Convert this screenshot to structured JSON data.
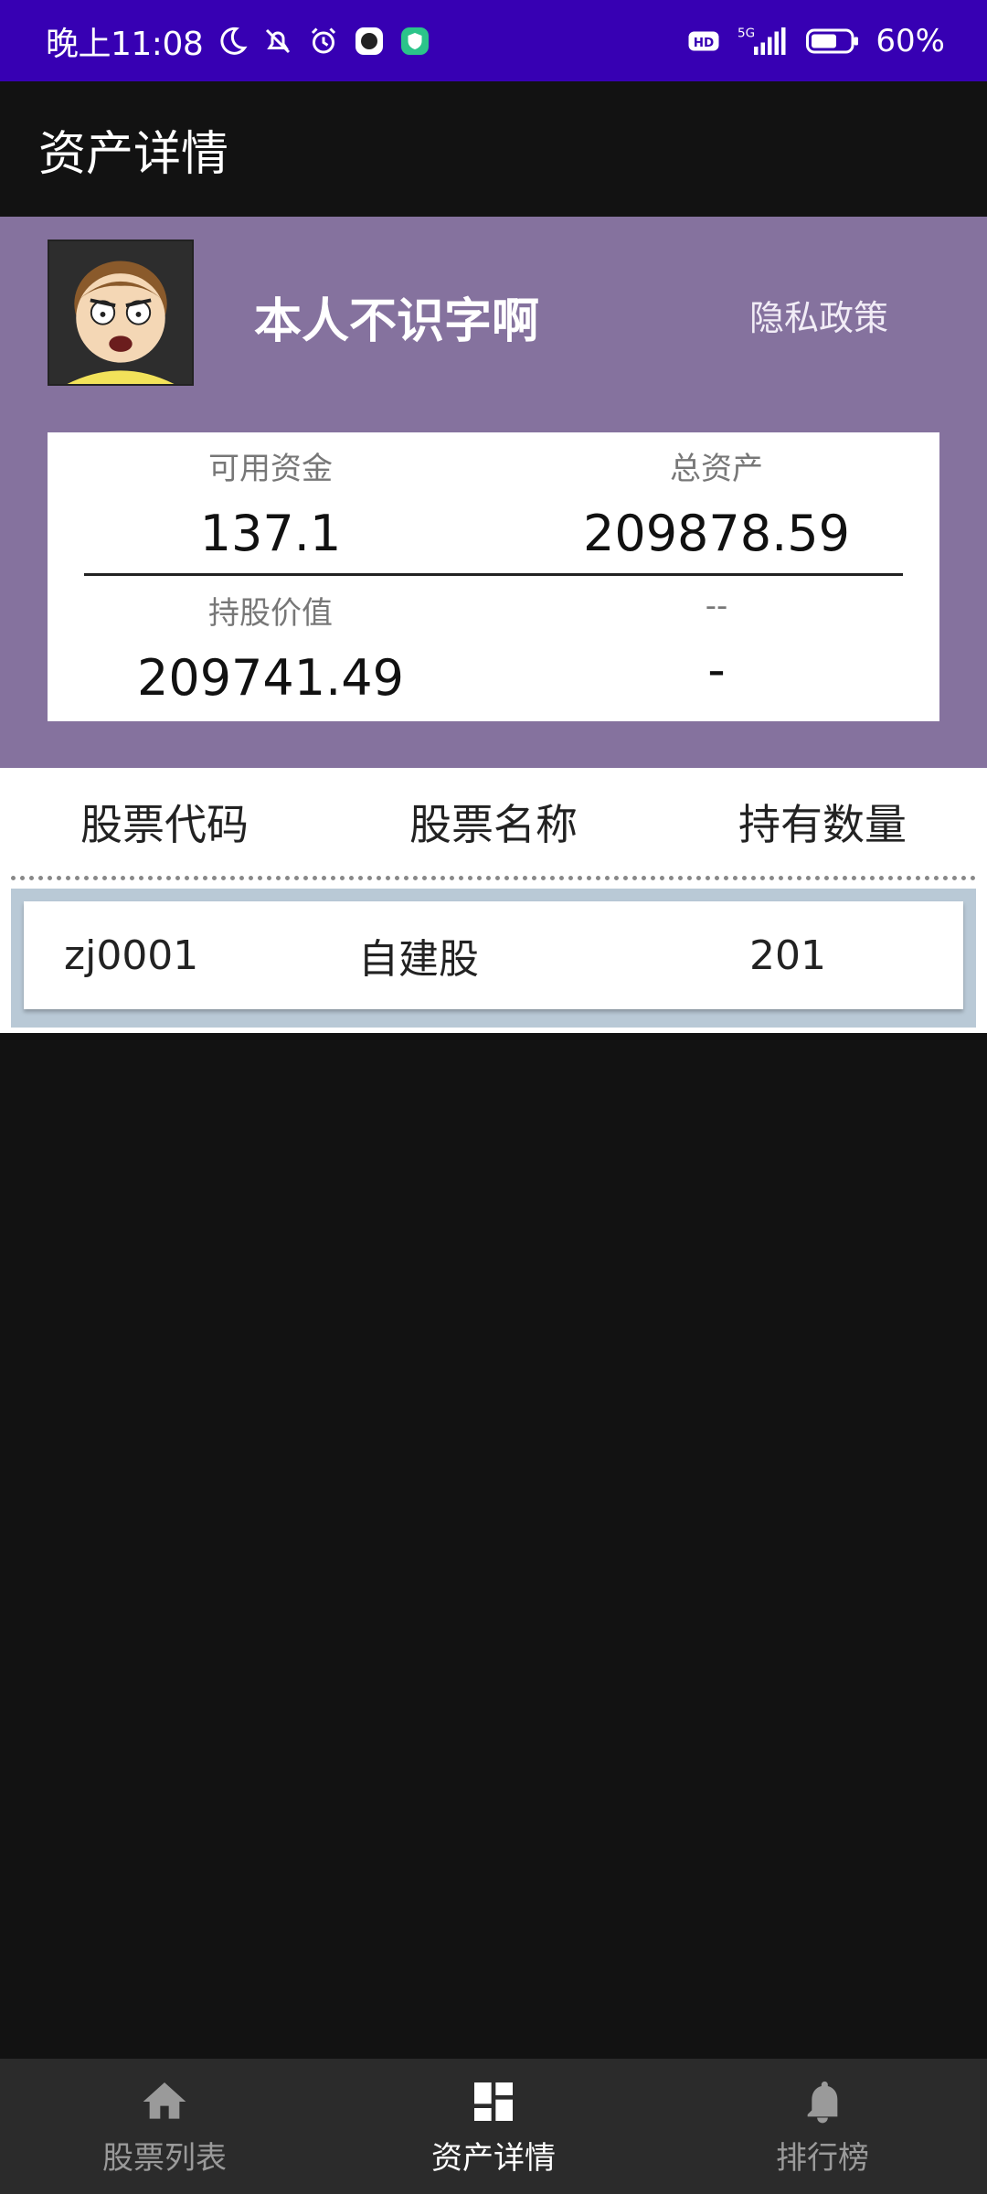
{
  "status_bar": {
    "time": "晚上11:08",
    "network": "5G",
    "battery": "60%"
  },
  "app_bar": {
    "title": "资产详情"
  },
  "profile": {
    "name": "本人不识字啊",
    "privacy_link": "隐私政策"
  },
  "summary": {
    "available_funds_label": "可用资金",
    "available_funds_value": "137.1",
    "total_assets_label": "总资产",
    "total_assets_value": "209878.59",
    "holding_value_label": "持股价值",
    "holding_value_value": "209741.49",
    "extra_label": "--",
    "extra_value": "-"
  },
  "holdings": {
    "columns": [
      "股票代码",
      "股票名称",
      "持有数量"
    ],
    "rows": [
      {
        "code": "zj0001",
        "name": "自建股",
        "quantity": "201"
      }
    ]
  },
  "bottom_nav": {
    "items": [
      {
        "label": "股票列表",
        "icon": "home-icon",
        "active": false
      },
      {
        "label": "资产详情",
        "icon": "dashboard-icon",
        "active": true
      },
      {
        "label": "排行榜",
        "icon": "bell-icon",
        "active": false
      }
    ]
  },
  "colors": {
    "status_bar": "#3700b3",
    "profile_bg": "#85729e",
    "row_border": "#b9c9d6"
  }
}
